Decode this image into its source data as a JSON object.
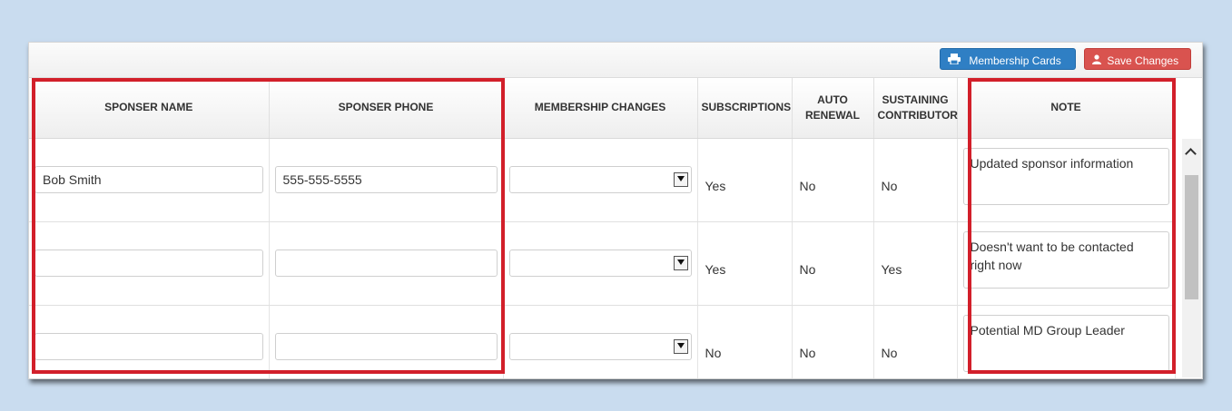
{
  "toolbar": {
    "membership_cards_label": "Membership Cards",
    "save_changes_label": "Save Changes"
  },
  "columns": {
    "sponser_name": "SPONSER NAME",
    "sponser_phone": "SPONSER PHONE",
    "membership_changes": "MEMBERSHIP CHANGES",
    "subscriptions": "SUBSCRIPTIONS",
    "auto_renewal": "AUTO RENEWAL",
    "sustaining_contributor": "SUSTAINING CONTRIBUTOR",
    "note": "NOTE"
  },
  "rows": [
    {
      "sponser_name": "Bob Smith",
      "sponser_phone": "555-555-5555",
      "membership_change": "",
      "subscriptions": "Yes",
      "auto_renewal": "No",
      "sustaining_contributor": "No",
      "note": "Updated sponsor information"
    },
    {
      "sponser_name": "",
      "sponser_phone": "",
      "membership_change": "",
      "subscriptions": "Yes",
      "auto_renewal": "No",
      "sustaining_contributor": "Yes",
      "note": "Doesn't want to be contacted right now"
    },
    {
      "sponser_name": "",
      "sponser_phone": "",
      "membership_change": "",
      "subscriptions": "No",
      "auto_renewal": "No",
      "sustaining_contributor": "No",
      "note": "Potential MD Group Leader"
    }
  ],
  "colors": {
    "background": "#c9dcef",
    "primary_button": "#2f7fc4",
    "danger_button": "#d9534f",
    "highlight": "#d21f2a"
  },
  "icons": {
    "membership_cards": "printer-icon",
    "save_changes": "user-icon",
    "select": "chevron-down-icon",
    "scroll_up": "chevron-up-icon"
  }
}
